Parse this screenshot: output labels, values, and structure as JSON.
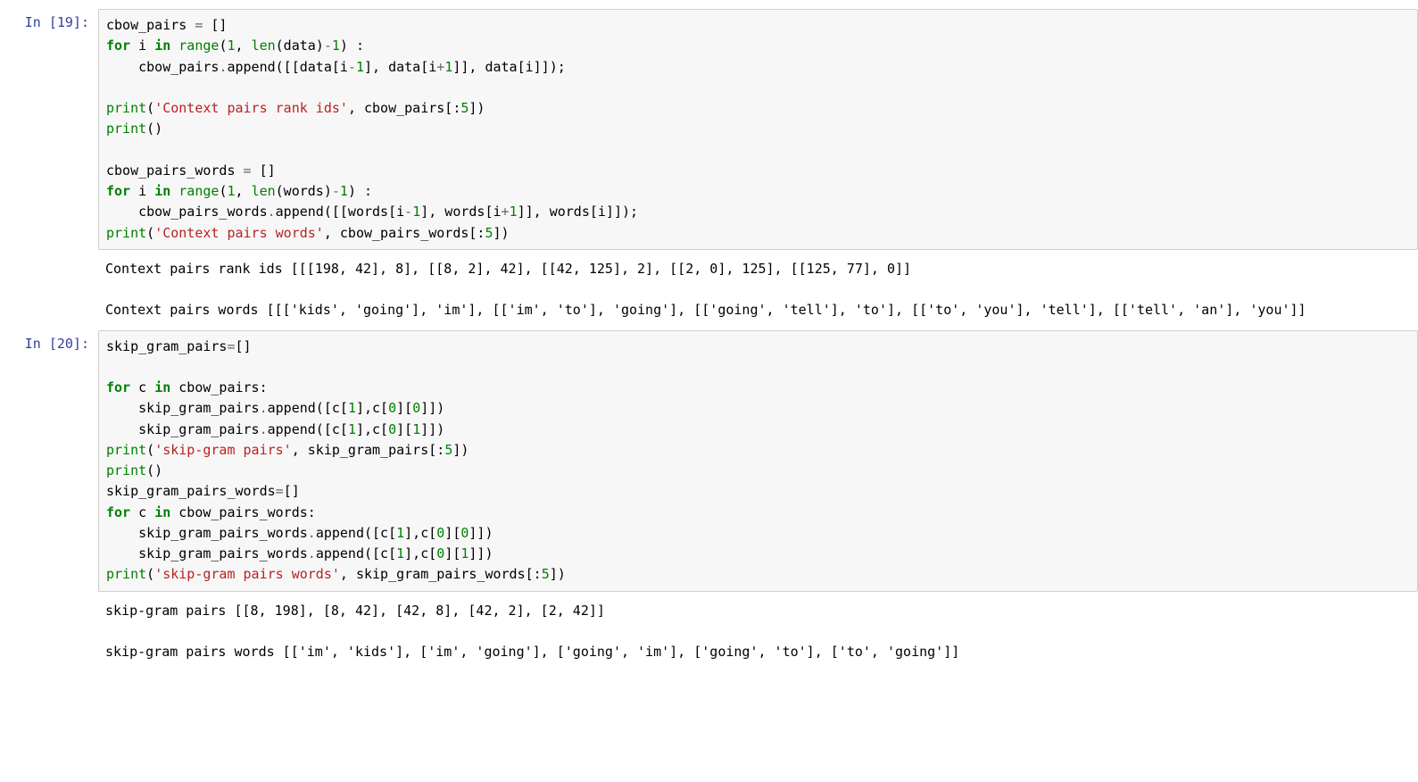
{
  "cells": [
    {
      "prompt": "In [19]:",
      "code_tokens": [
        [
          "",
          "cbow_pairs "
        ],
        [
          "op",
          "="
        ],
        [
          "",
          " []"
        ],
        [
          "br",
          ""
        ],
        [
          "kw-green",
          "for"
        ],
        [
          "",
          " i "
        ],
        [
          "kw-green",
          "in"
        ],
        [
          "",
          " "
        ],
        [
          "builtin",
          "range"
        ],
        [
          "",
          "("
        ],
        [
          "num-green",
          "1"
        ],
        [
          "",
          ", "
        ],
        [
          "builtin",
          "len"
        ],
        [
          "",
          "(data)"
        ],
        [
          "op",
          "-"
        ],
        [
          "num-green",
          "1"
        ],
        [
          "",
          ") :"
        ],
        [
          "br",
          ""
        ],
        [
          "",
          "    cbow_pairs"
        ],
        [
          "op",
          "."
        ],
        [
          "",
          "append([[data[i"
        ],
        [
          "op",
          "-"
        ],
        [
          "num-green",
          "1"
        ],
        [
          "",
          "], data[i"
        ],
        [
          "op",
          "+"
        ],
        [
          "num-green",
          "1"
        ],
        [
          "",
          "]], data[i]]);"
        ],
        [
          "br",
          ""
        ],
        [
          "br",
          ""
        ],
        [
          "builtin",
          "print"
        ],
        [
          "",
          "("
        ],
        [
          "str",
          "'Context pairs rank ids'"
        ],
        [
          "",
          ", cbow_pairs[:"
        ],
        [
          "num-green",
          "5"
        ],
        [
          "",
          "])"
        ],
        [
          "br",
          ""
        ],
        [
          "builtin",
          "print"
        ],
        [
          "",
          "()"
        ],
        [
          "br",
          ""
        ],
        [
          "br",
          ""
        ],
        [
          "",
          "cbow_pairs_words "
        ],
        [
          "op",
          "="
        ],
        [
          "",
          " []"
        ],
        [
          "br",
          ""
        ],
        [
          "kw-green",
          "for"
        ],
        [
          "",
          " i "
        ],
        [
          "kw-green",
          "in"
        ],
        [
          "",
          " "
        ],
        [
          "builtin",
          "range"
        ],
        [
          "",
          "("
        ],
        [
          "num-green",
          "1"
        ],
        [
          "",
          ", "
        ],
        [
          "builtin",
          "len"
        ],
        [
          "",
          "(words)"
        ],
        [
          "op",
          "-"
        ],
        [
          "num-green",
          "1"
        ],
        [
          "",
          ") :"
        ],
        [
          "br",
          ""
        ],
        [
          "",
          "    cbow_pairs_words"
        ],
        [
          "op",
          "."
        ],
        [
          "",
          "append([[words[i"
        ],
        [
          "op",
          "-"
        ],
        [
          "num-green",
          "1"
        ],
        [
          "",
          "], words[i"
        ],
        [
          "op",
          "+"
        ],
        [
          "num-green",
          "1"
        ],
        [
          "",
          "]], words[i]]);"
        ],
        [
          "br",
          ""
        ],
        [
          "builtin",
          "print"
        ],
        [
          "",
          "("
        ],
        [
          "str",
          "'Context pairs words'"
        ],
        [
          "",
          ", cbow_pairs_words[:"
        ],
        [
          "num-green",
          "5"
        ],
        [
          "",
          "])"
        ]
      ],
      "output": "Context pairs rank ids [[[198, 42], 8], [[8, 2], 42], [[42, 125], 2], [[2, 0], 125], [[125, 77], 0]]\n\nContext pairs words [[['kids', 'going'], 'im'], [['im', 'to'], 'going'], [['going', 'tell'], 'to'], [['to', 'you'], 'tell'], [['tell', 'an'], 'you']]"
    },
    {
      "prompt": "In [20]:",
      "code_tokens": [
        [
          "",
          "skip_gram_pairs"
        ],
        [
          "op",
          "="
        ],
        [
          "",
          "[]"
        ],
        [
          "br",
          ""
        ],
        [
          "br",
          ""
        ],
        [
          "kw-green",
          "for"
        ],
        [
          "",
          " c "
        ],
        [
          "kw-green",
          "in"
        ],
        [
          "",
          " cbow_pairs:"
        ],
        [
          "br",
          ""
        ],
        [
          "",
          "    skip_gram_pairs"
        ],
        [
          "op",
          "."
        ],
        [
          "",
          "append([c["
        ],
        [
          "num-green",
          "1"
        ],
        [
          "",
          "],c["
        ],
        [
          "num-green",
          "0"
        ],
        [
          "",
          "]["
        ],
        [
          "num-green",
          "0"
        ],
        [
          "",
          "]])"
        ],
        [
          "br",
          ""
        ],
        [
          "",
          "    skip_gram_pairs"
        ],
        [
          "op",
          "."
        ],
        [
          "",
          "append([c["
        ],
        [
          "num-green",
          "1"
        ],
        [
          "",
          "],c["
        ],
        [
          "num-green",
          "0"
        ],
        [
          "",
          "]["
        ],
        [
          "num-green",
          "1"
        ],
        [
          "",
          "]])"
        ],
        [
          "br",
          ""
        ],
        [
          "builtin",
          "print"
        ],
        [
          "",
          "("
        ],
        [
          "str",
          "'skip-gram pairs'"
        ],
        [
          "",
          ", skip_gram_pairs[:"
        ],
        [
          "num-green",
          "5"
        ],
        [
          "",
          "])"
        ],
        [
          "br",
          ""
        ],
        [
          "builtin",
          "print"
        ],
        [
          "",
          "()"
        ],
        [
          "br",
          ""
        ],
        [
          "",
          "skip_gram_pairs_words"
        ],
        [
          "op",
          "="
        ],
        [
          "",
          "[]"
        ],
        [
          "br",
          ""
        ],
        [
          "kw-green",
          "for"
        ],
        [
          "",
          " c "
        ],
        [
          "kw-green",
          "in"
        ],
        [
          "",
          " cbow_pairs_words:"
        ],
        [
          "br",
          ""
        ],
        [
          "",
          "    skip_gram_pairs_words"
        ],
        [
          "op",
          "."
        ],
        [
          "",
          "append([c["
        ],
        [
          "num-green",
          "1"
        ],
        [
          "",
          "],c["
        ],
        [
          "num-green",
          "0"
        ],
        [
          "",
          "]["
        ],
        [
          "num-green",
          "0"
        ],
        [
          "",
          "]])"
        ],
        [
          "br",
          ""
        ],
        [
          "",
          "    skip_gram_pairs_words"
        ],
        [
          "op",
          "."
        ],
        [
          "",
          "append([c["
        ],
        [
          "num-green",
          "1"
        ],
        [
          "",
          "],c["
        ],
        [
          "num-green",
          "0"
        ],
        [
          "",
          "]["
        ],
        [
          "num-green",
          "1"
        ],
        [
          "",
          "]])"
        ],
        [
          "br",
          ""
        ],
        [
          "builtin",
          "print"
        ],
        [
          "",
          "("
        ],
        [
          "str",
          "'skip-gram pairs words'"
        ],
        [
          "",
          ", skip_gram_pairs_words[:"
        ],
        [
          "num-green",
          "5"
        ],
        [
          "",
          "])"
        ]
      ],
      "output": "skip-gram pairs [[8, 198], [8, 42], [42, 8], [42, 2], [2, 42]]\n\nskip-gram pairs words [['im', 'kids'], ['im', 'going'], ['going', 'im'], ['going', 'to'], ['to', 'going']]"
    }
  ]
}
